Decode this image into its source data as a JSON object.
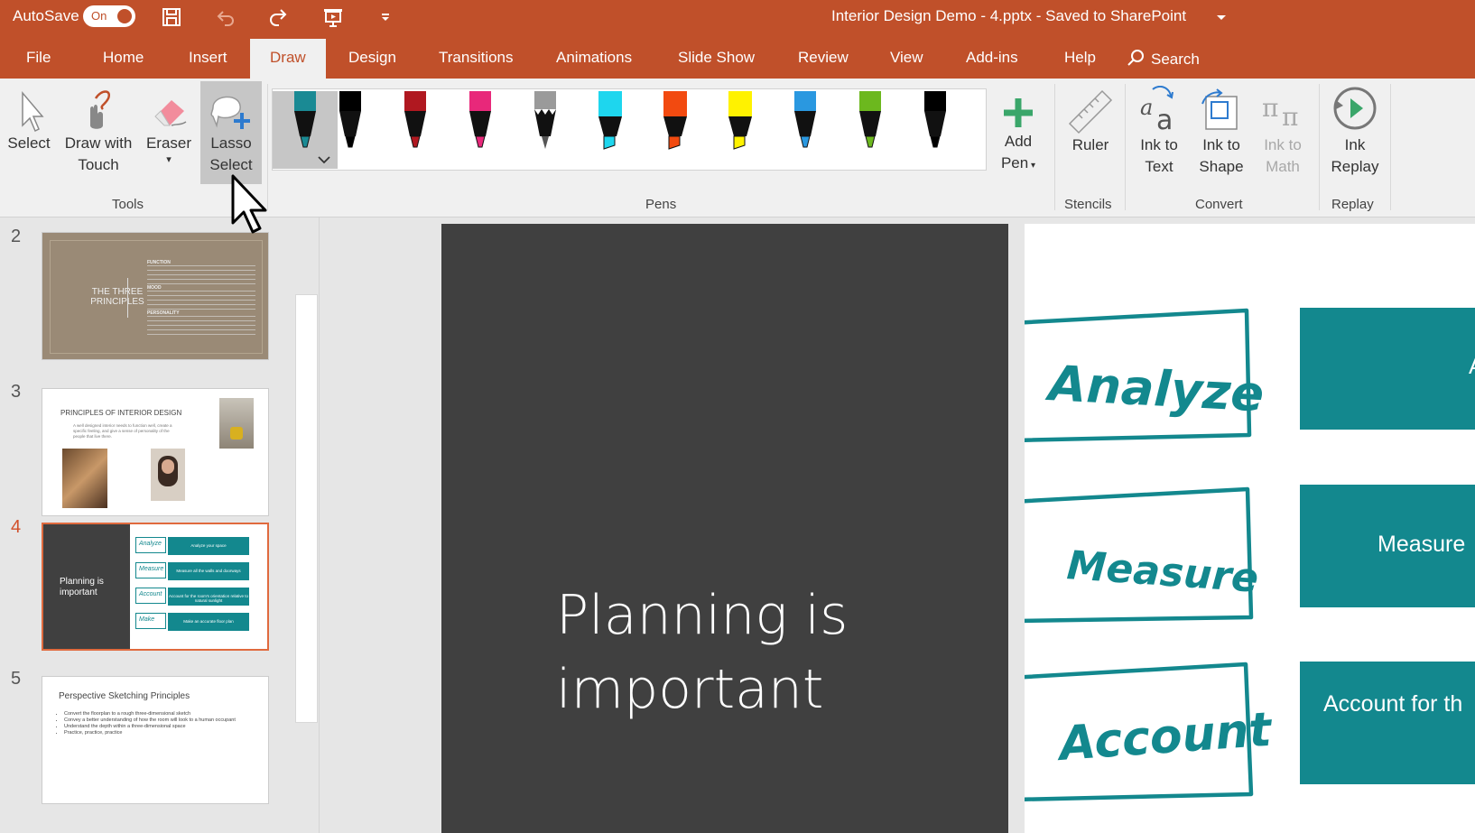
{
  "titlebar": {
    "autosave_label": "AutoSave",
    "autosave_state": "On",
    "doc_title": "Interior Design Demo - 4.pptx  -  Saved to SharePoint",
    "icons": [
      "save-icon",
      "undo-icon",
      "redo-icon",
      "present-icon",
      "customize-icon"
    ]
  },
  "tabs": {
    "file": "File",
    "home": "Home",
    "insert": "Insert",
    "draw": "Draw",
    "design": "Design",
    "transitions": "Transitions",
    "animations": "Animations",
    "slideshow": "Slide Show",
    "review": "Review",
    "view": "View",
    "addins": "Add-ins",
    "help": "Help",
    "search": "Search"
  },
  "ribbon": {
    "tools": {
      "select": "Select",
      "draw_touch_1": "Draw with",
      "draw_touch_2": "Touch",
      "eraser": "Eraser",
      "lasso_1": "Lasso",
      "lasso_2": "Select",
      "group": "Tools"
    },
    "pens": {
      "group": "Pens",
      "items": [
        {
          "color": "#1a8a94",
          "kind": "pen"
        },
        {
          "color": "#000000",
          "kind": "pen"
        },
        {
          "color": "#b01820",
          "kind": "pen"
        },
        {
          "color": "#e8287a",
          "kind": "pen"
        },
        {
          "color": "#9a9a9a",
          "kind": "pencil"
        },
        {
          "color": "#1ed6ee",
          "kind": "highlighter"
        },
        {
          "color": "#f24a10",
          "kind": "highlighter"
        },
        {
          "color": "#fff200",
          "kind": "highlighter"
        },
        {
          "color": "#2a98e0",
          "kind": "pen"
        },
        {
          "color": "#6cb81e",
          "kind": "pen"
        },
        {
          "color": "#000000",
          "kind": "pen"
        }
      ],
      "add_1": "Add",
      "add_2": "Pen"
    },
    "stencils": {
      "ruler": "Ruler",
      "group": "Stencils"
    },
    "convert": {
      "ink_text_1": "Ink to",
      "ink_text_2": "Text",
      "ink_shape_1": "Ink to",
      "ink_shape_2": "Shape",
      "ink_math_1": "Ink to",
      "ink_math_2": "Math",
      "group": "Convert"
    },
    "replay": {
      "ink_replay_1": "Ink",
      "ink_replay_2": "Replay",
      "group": "Replay"
    }
  },
  "thumbnails": [
    {
      "num": "2",
      "title_1": "THE THREE",
      "title_2": "PRINCIPLES",
      "items": [
        "FUNCTION",
        "MOOD",
        "PERSONALITY"
      ]
    },
    {
      "num": "3",
      "title": "PRINCIPLES OF INTERIOR DESIGN",
      "body": "A well designed interior needs to function well, create a specific feeling, and give a sense of personality of the people that live there."
    },
    {
      "num": "4",
      "title_1": "Planning is",
      "title_2": "important",
      "words": [
        "Analyze",
        "Measure",
        "Account",
        "Make"
      ],
      "bars": [
        "Analyze your space",
        "Measure all the walls and doorways",
        "Account for the room's orientation relative to natural sunlight",
        "Make an accurate floor plan"
      ]
    },
    {
      "num": "5",
      "title": "Perspective Sketching Principles",
      "bullets": [
        "Convert the floorplan to a rough three-dimensional sketch",
        "Convey a better understanding of how the room will look to a human occupant",
        "Understand the depth within a three-dimensional space",
        "Practice, practice, practice"
      ]
    }
  ],
  "slide": {
    "title_1": "Planning is",
    "title_2": "important",
    "ink_words": [
      "Analyze",
      "Measure",
      "Account"
    ],
    "bars": [
      "A",
      "Measure",
      "Account for th"
    ]
  },
  "colors": {
    "accent": "#c0502a",
    "teal": "#13888e",
    "ink": "#13888e",
    "selected_border": "#e06a3e"
  }
}
